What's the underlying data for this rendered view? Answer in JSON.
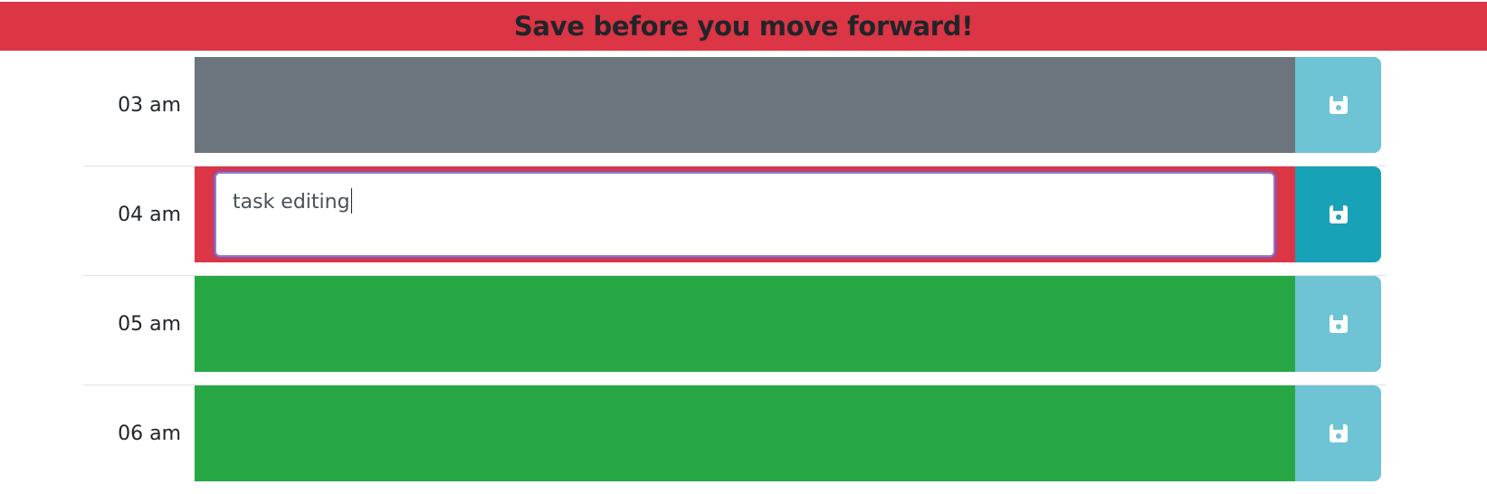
{
  "header": {
    "alert_text": "Save before you move forward!"
  },
  "colors": {
    "alert": "#dc3545",
    "past": "#6c757d",
    "present": "#dc3545",
    "future": "#28a745",
    "save_button": "#6ec4d4",
    "save_button_active": "#17a2b8"
  },
  "rows": [
    {
      "hour": "03 am",
      "state": "past",
      "task": ""
    },
    {
      "hour": "04 am",
      "state": "present",
      "task": "task editing"
    },
    {
      "hour": "05 am",
      "state": "future",
      "task": ""
    },
    {
      "hour": "06 am",
      "state": "future",
      "task": ""
    }
  ],
  "icons": {
    "save": "floppy-disk-icon"
  }
}
